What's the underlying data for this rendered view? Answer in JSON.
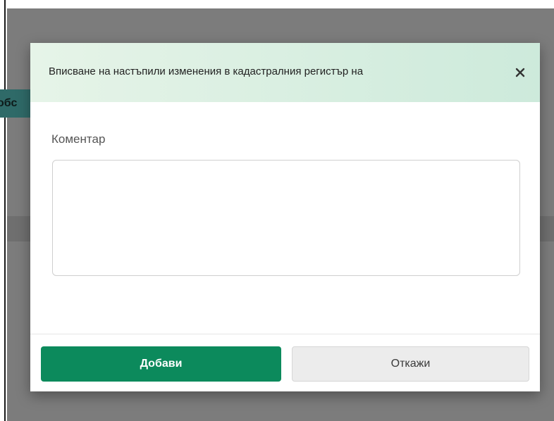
{
  "background": {
    "tab_text": "обс"
  },
  "modal": {
    "title": "Вписване на настъпили изменения в кадастралния регистър на",
    "close_icon": "close-icon",
    "comment_label": "Коментар",
    "comment_value": "",
    "comment_placeholder": "",
    "add_button_label": "Добави",
    "cancel_button_label": "Откажи"
  },
  "colors": {
    "primary": "#0c8a5c",
    "header_gradient_start": "#e6f4e8",
    "header_gradient_end": "#cdeadb",
    "overlay": "#7c7c7c"
  }
}
